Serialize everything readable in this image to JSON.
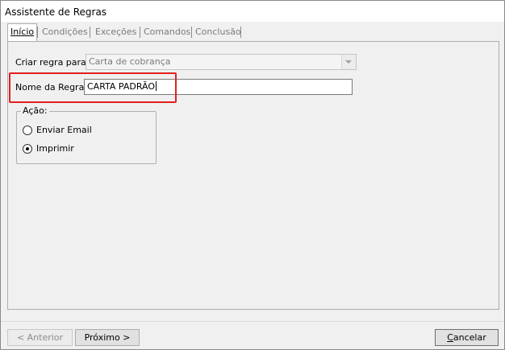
{
  "window": {
    "title": "Assistente de Regras"
  },
  "tabs": [
    {
      "label": "Início",
      "active": true
    },
    {
      "label": "Condições",
      "active": false
    },
    {
      "label": "Exceções",
      "active": false
    },
    {
      "label": "Comandos",
      "active": false
    },
    {
      "label": "Conclusão",
      "active": false
    }
  ],
  "form": {
    "criar_label": "Criar regra para:",
    "criar_value": "Carta de cobrança",
    "nome_label": "Nome da Regra:",
    "nome_value": "CARTA PADRÃO"
  },
  "acao": {
    "legend": "Ação:",
    "options": [
      {
        "label": "Enviar Email",
        "checked": false
      },
      {
        "label": "Imprimir",
        "checked": true
      }
    ]
  },
  "buttons": {
    "anterior": "< Anterior",
    "proximo": "Próximo >",
    "cancelar_pre": "",
    "cancelar_ul": "C",
    "cancelar_post": "ancelar"
  },
  "colors": {
    "highlight": "#e32020"
  }
}
